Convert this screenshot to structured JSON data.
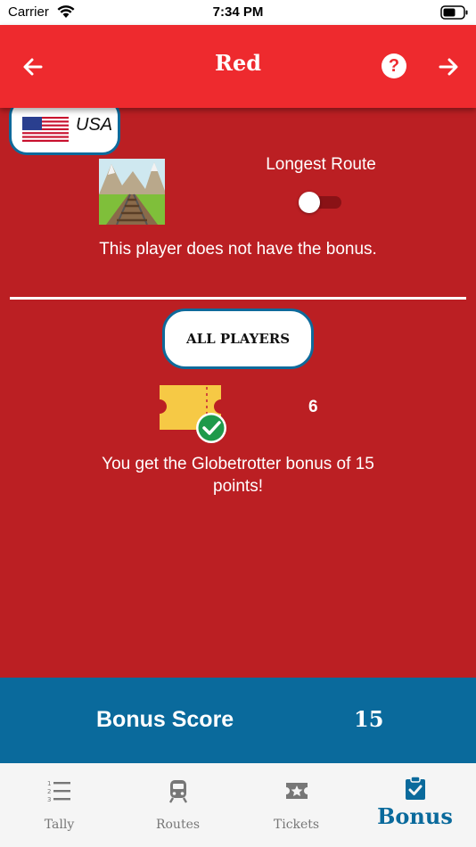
{
  "status_bar": {
    "carrier": "Carrier",
    "time": "7:34 PM"
  },
  "navbar": {
    "title": "Red",
    "back_icon": "arrow-left-icon",
    "help_icon": "question-icon",
    "next_icon": "arrow-right-icon"
  },
  "player": {
    "country": "USA",
    "flag_icon": "us-flag-icon"
  },
  "longest_route": {
    "label": "Longest Route",
    "enabled": false,
    "message": "This player does not have the bonus.",
    "image_icon": "railway-track-icon"
  },
  "all_players": {
    "button_label": "ALL PLAYERS",
    "ticket_icon": "ticket-check-icon",
    "ticket_count": "6",
    "message": "You get the Globetrotter bonus of 15 points!"
  },
  "bonus_score": {
    "label": "Bonus Score",
    "value": "15"
  },
  "tabs": [
    {
      "label": "Tally",
      "icon": "list-numbered-icon",
      "active": false
    },
    {
      "label": "Routes",
      "icon": "train-icon",
      "active": false
    },
    {
      "label": "Tickets",
      "icon": "star-ticket-icon",
      "active": false
    },
    {
      "label": "Bonus",
      "icon": "clipboard-check-icon",
      "active": true
    }
  ],
  "colors": {
    "primary_red": "#ee2a2e",
    "content_red": "#bb1f23",
    "accent_blue": "#0a6a9c"
  }
}
